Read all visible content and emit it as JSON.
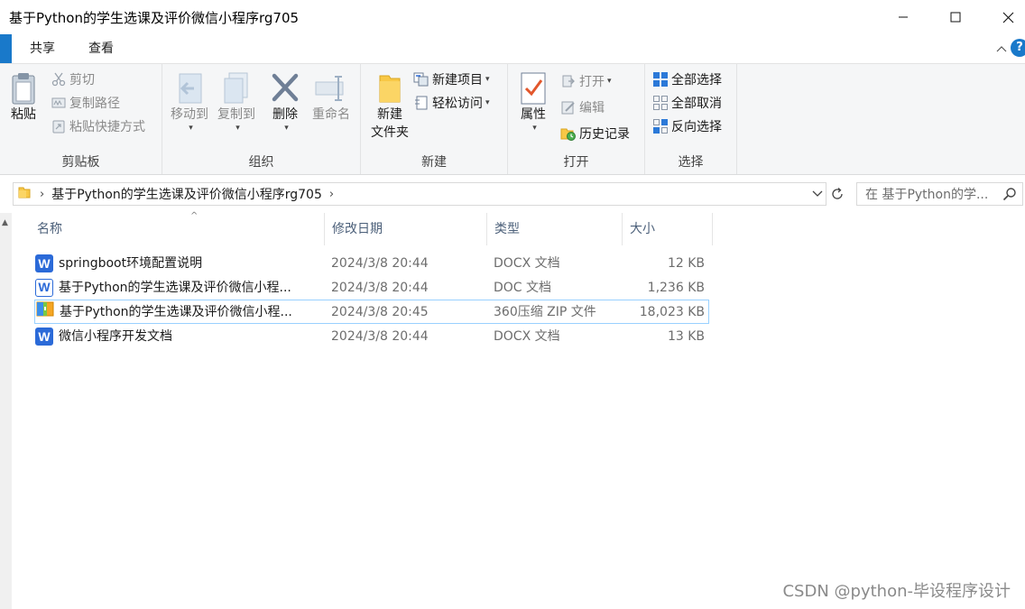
{
  "window": {
    "title": "基于Python的学生选课及评价微信小程序rg705"
  },
  "tabs": [
    {
      "label": "共享"
    },
    {
      "label": "查看"
    }
  ],
  "ribbon": {
    "clipboard": {
      "label": "剪贴板",
      "paste": "粘贴",
      "cut": "剪切",
      "copy_path": "复制路径",
      "paste_shortcut": "粘贴快捷方式"
    },
    "organize": {
      "label": "组织",
      "move_to": "移动到",
      "copy_to": "复制到",
      "delete": "删除",
      "rename": "重命名"
    },
    "new": {
      "label": "新建",
      "new_folder_line1": "新建",
      "new_folder_line2": "文件夹",
      "new_item": "新建项目",
      "easy_access": "轻松访问"
    },
    "open": {
      "label": "打开",
      "properties": "属性",
      "open": "打开",
      "edit": "编辑",
      "history": "历史记录"
    },
    "select": {
      "label": "选择",
      "select_all": "全部选择",
      "select_none": "全部取消",
      "invert": "反向选择"
    }
  },
  "address": {
    "path": "基于Python的学生选课及评价微信小程序rg705",
    "search_placeholder": "在 基于Python的学..."
  },
  "columns": {
    "name": "名称",
    "date": "修改日期",
    "type": "类型",
    "size": "大小"
  },
  "files": [
    {
      "name": "springboot环境配置说明",
      "date": "2024/3/8 20:44",
      "type": "DOCX 文档",
      "size": "12 KB",
      "icon": "word-docx-icon"
    },
    {
      "name": "基于Python的学生选课及评价微信小程...",
      "date": "2024/3/8 20:44",
      "type": "DOC 文档",
      "size": "1,236 KB",
      "icon": "word-doc-icon"
    },
    {
      "name": "基于Python的学生选课及评价微信小程...",
      "date": "2024/3/8 20:45",
      "type": "360压缩 ZIP 文件",
      "size": "18,023 KB",
      "icon": "zip-archive-icon"
    },
    {
      "name": "微信小程序开发文档",
      "date": "2024/3/8 20:44",
      "type": "DOCX 文档",
      "size": "13 KB",
      "icon": "word-docx-icon"
    }
  ],
  "watermark": "CSDN @python-毕设程序设计",
  "colors": {
    "accent": "#1979ca",
    "ribbon_bg": "#f5f6f7",
    "header_text": "#4c607a",
    "selection_border": "#99d1ff"
  }
}
